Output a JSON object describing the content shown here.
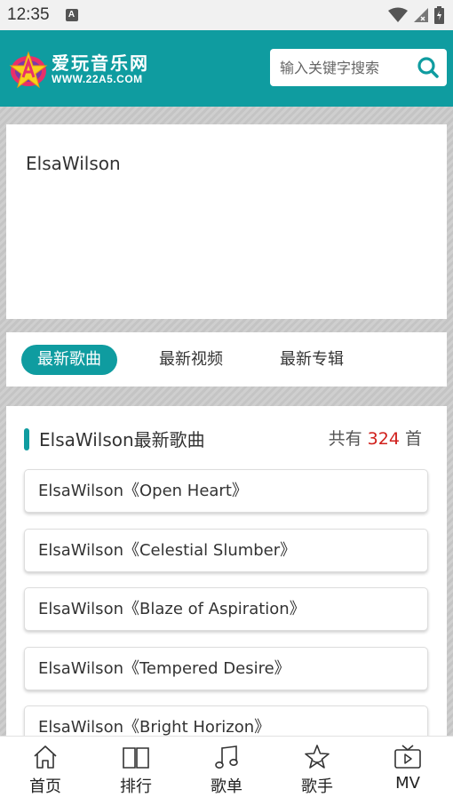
{
  "status_bar": {
    "time": "12:35",
    "notif_letter": "A"
  },
  "header": {
    "logo_cn": "爱玩音乐网",
    "logo_url": "WWW.22A5.COM",
    "search_placeholder": "输入关键字搜索"
  },
  "artist": {
    "name": "ElsaWilson"
  },
  "tabs": [
    {
      "label": "最新歌曲",
      "active": true
    },
    {
      "label": "最新视频",
      "active": false
    },
    {
      "label": "最新专辑",
      "active": false
    }
  ],
  "songs_section": {
    "title": "ElsaWilson最新歌曲",
    "count_prefix": "共有",
    "count": "324",
    "count_suffix": "首",
    "items": [
      "ElsaWilson《Open Heart》",
      "ElsaWilson《Celestial Slumber》",
      "ElsaWilson《Blaze of Aspiration》",
      "ElsaWilson《Tempered Desire》",
      "ElsaWilson《Bright Horizon》"
    ]
  },
  "bottom_nav": [
    {
      "label": "首页",
      "icon": "home-icon"
    },
    {
      "label": "排行",
      "icon": "book-icon"
    },
    {
      "label": "歌单",
      "icon": "music-note-icon"
    },
    {
      "label": "歌手",
      "icon": "star-icon"
    },
    {
      "label": "MV",
      "icon": "tv-icon"
    }
  ],
  "colors": {
    "accent": "#0f9ca0",
    "count_red": "#d0201c"
  }
}
